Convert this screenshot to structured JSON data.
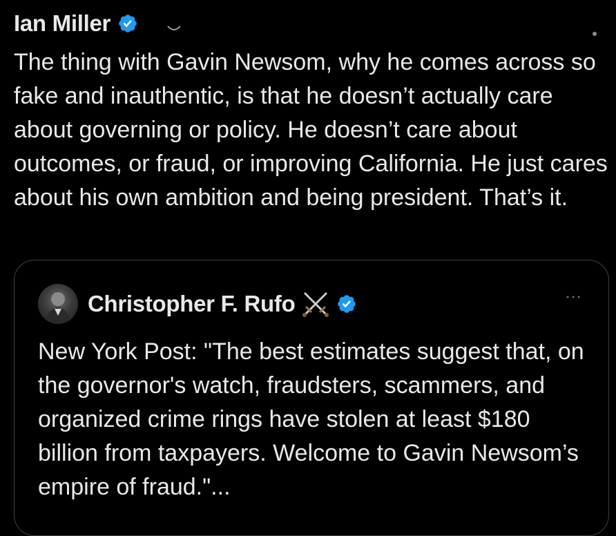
{
  "tweet": {
    "author_name": "Ian Miller",
    "text": "The thing with Gavin Newsom, why he comes across so fake and inauthentic, is that he doesn’t actually care about governing or policy. He doesn’t care about outcomes, or fraud, or improving California. He just cares about his own ambition and being president. That’s it."
  },
  "quoted_tweet": {
    "author_name": "Christopher F. Rufo",
    "author_emoji": "⚔️",
    "text": "New York Post: \"The best estimates suggest that, on the governor's watch, fraudsters, scammers, and organized crime rings have stolen at least $180 billion from taxpayers. Welcome to Gavin Newsom’s empire of fraud.\"..."
  },
  "icons": {
    "verified": "verified-badge-icon",
    "swords": "crossed-swords-icon",
    "more": "more-options-icon"
  },
  "colors": {
    "background": "#000000",
    "text": "#e7e9ea",
    "verified_blue": "#1d9bf0",
    "border": "#3e4144"
  }
}
